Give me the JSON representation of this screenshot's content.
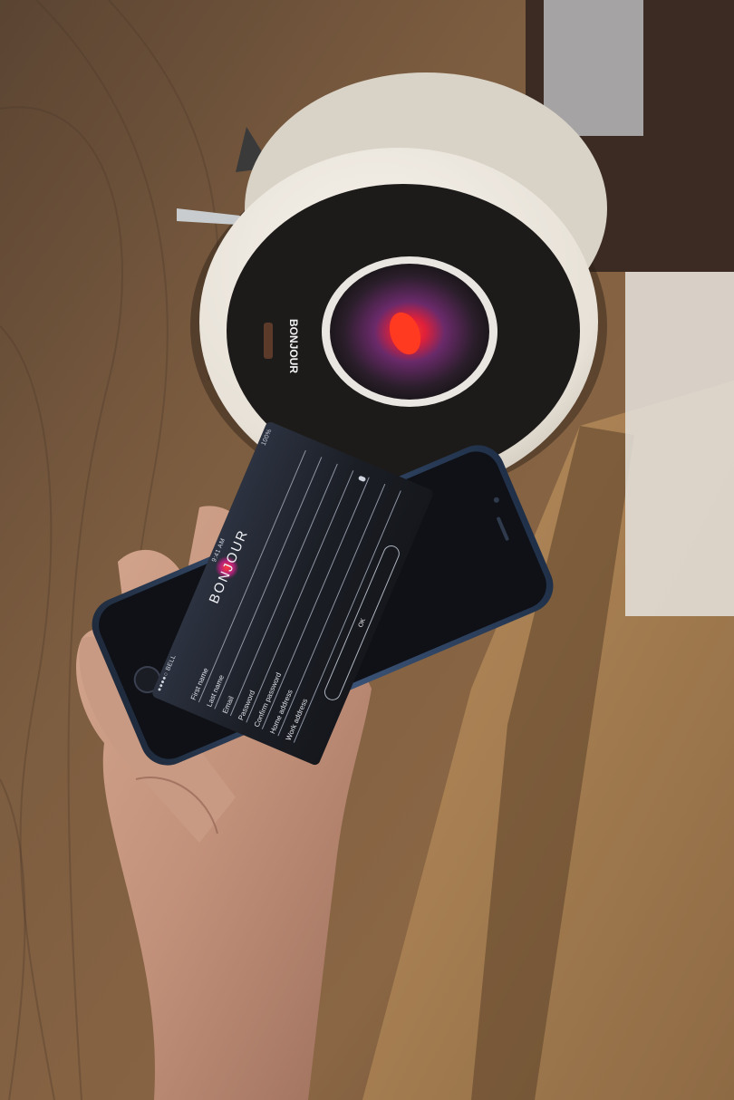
{
  "device": {
    "brand_label": "BONJOUR"
  },
  "app": {
    "status_bar": {
      "carrier": "●●●●○ BELL",
      "time": "9:41 AM",
      "battery": "100%"
    },
    "brand": "BONJOUR",
    "fields": [
      {
        "label": "First name"
      },
      {
        "label": "Last name"
      },
      {
        "label": "Email"
      },
      {
        "label": "Password"
      },
      {
        "label": "Confirm password"
      },
      {
        "label": "Home address"
      },
      {
        "label": "Work address"
      }
    ],
    "ok_label": "OK"
  },
  "colors": {
    "wood": "#8a6644",
    "device_body": "#ece7df",
    "device_face": "#1c1a19",
    "eye_red": "#ff2a1e",
    "phone_frame": "#2d3f5c",
    "screen_bg": "#1b1e25"
  }
}
